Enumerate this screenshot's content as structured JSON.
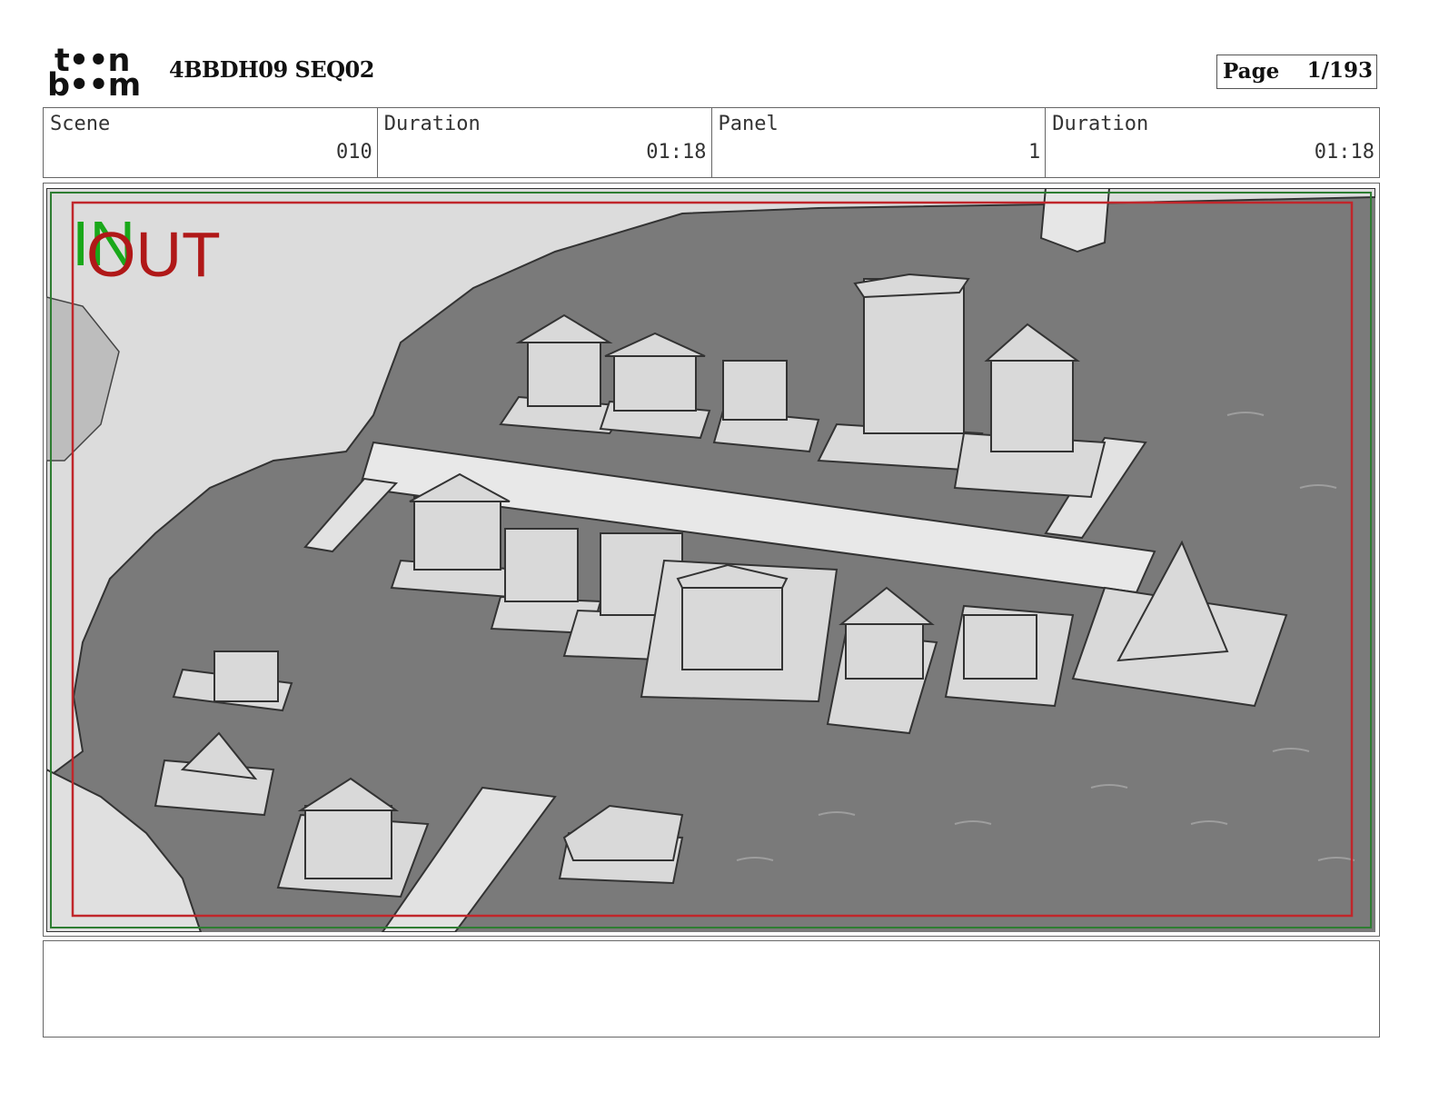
{
  "header": {
    "logo_top": "t••n",
    "logo_bottom": "b••m",
    "title": "4BBDH09 SEQ02",
    "page_label": "Page",
    "page_value": "1/193"
  },
  "info": {
    "scene_label": "Scene",
    "scene_value": "010",
    "scene_duration_label": "Duration",
    "scene_duration_value": "01:18",
    "panel_label": "Panel",
    "panel_value": "1",
    "panel_duration_label": "Duration",
    "panel_duration_value": "01:18"
  },
  "panel": {
    "in_label": "IN",
    "out_label": "OUT",
    "in_color": "#1aa81a",
    "out_color": "#b01818",
    "water_color": "#7a7a7a",
    "safe_frame_color": "#c0262b",
    "outer_frame_color": "#2e7d32"
  },
  "notes": {
    "text": ""
  }
}
